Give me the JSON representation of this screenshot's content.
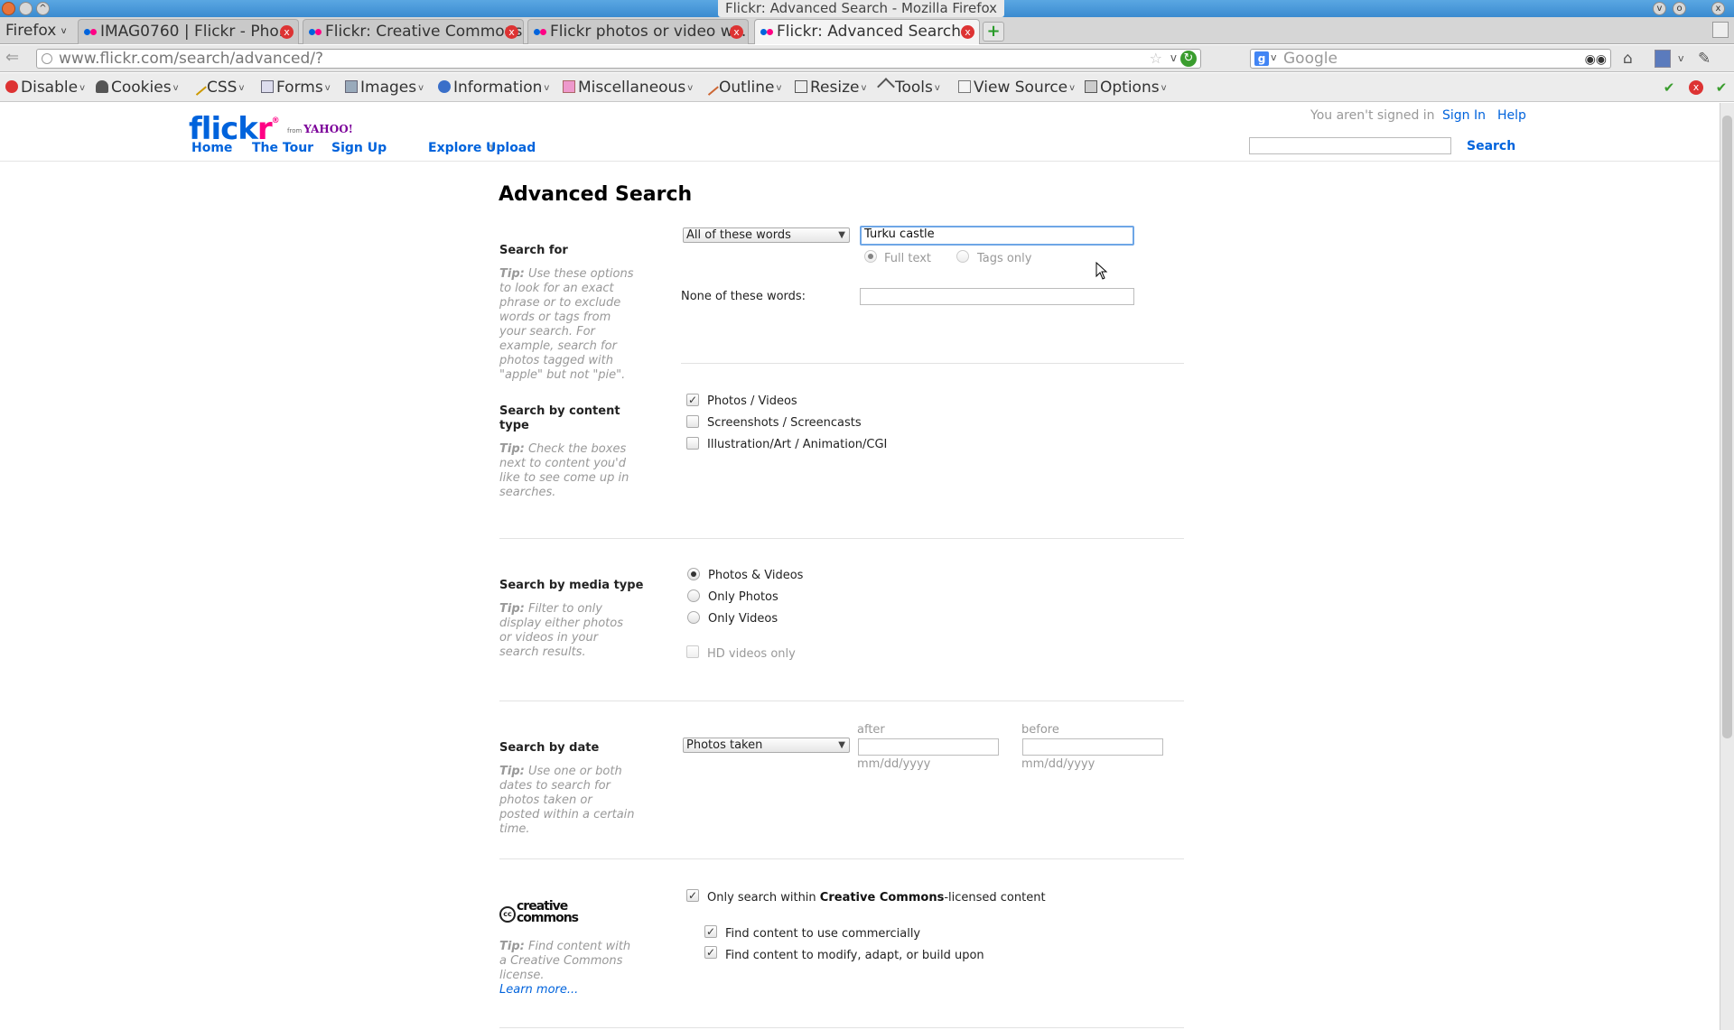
{
  "window": {
    "title": "Flickr: Advanced Search - Mozilla Firefox"
  },
  "browser": {
    "menu_label": "Firefox",
    "tabs": [
      {
        "label": "IMAG0760 | Flickr - Pho..."
      },
      {
        "label": "Flickr: Creative Commons"
      },
      {
        "label": "Flickr photos or video w..."
      },
      {
        "label": "Flickr: Advanced Search"
      }
    ],
    "url": "www.flickr.com/search/advanced/?",
    "search_placeholder": "Google"
  },
  "devtoolbar": {
    "items": [
      {
        "label": "Disable"
      },
      {
        "label": "Cookies"
      },
      {
        "label": "CSS"
      },
      {
        "label": "Forms"
      },
      {
        "label": "Images"
      },
      {
        "label": "Information"
      },
      {
        "label": "Miscellaneous"
      },
      {
        "label": "Outline"
      },
      {
        "label": "Resize"
      },
      {
        "label": "Tools"
      },
      {
        "label": "View Source"
      },
      {
        "label": "Options"
      }
    ]
  },
  "flickr": {
    "logo_blue": "flick",
    "logo_pink": "r",
    "logo_from": "from",
    "logo_yahoo": "YAHOO!",
    "nav": [
      "Home",
      "The Tour",
      "Sign Up",
      "Explore",
      "Upload"
    ],
    "signed_out": "You aren't signed in",
    "sign_in": "Sign In",
    "help": "Help",
    "search_button": "Search",
    "colors": {
      "blue": "#0063dc",
      "pink": "#ff0084"
    }
  },
  "page": {
    "title": "Advanced Search",
    "search_for": {
      "label": "Search for",
      "tip_bold": "Tip:",
      "tip": "Use these options to look for an exact phrase or to exclude words or tags from your search. For example, search for photos tagged with \"apple\" but not \"pie\".",
      "mode_select": "All of these words",
      "query": "Turku castle",
      "full_text": "Full text",
      "tags_only": "Tags only",
      "none_label": "None of these words:",
      "none_value": ""
    },
    "content_type": {
      "label": "Search by content type",
      "tip_bold": "Tip:",
      "tip": "Check the boxes next to content you'd like to see come up in searches.",
      "options": [
        {
          "label": "Photos / Videos",
          "checked": true
        },
        {
          "label": "Screenshots / Screencasts",
          "checked": false
        },
        {
          "label": "Illustration/Art / Animation/CGI",
          "checked": false
        }
      ]
    },
    "media_type": {
      "label": "Search by media type",
      "tip_bold": "Tip:",
      "tip": "Filter to only display either photos or videos in your search results.",
      "options": [
        {
          "label": "Photos & Videos",
          "selected": true
        },
        {
          "label": "Only Photos",
          "selected": false
        },
        {
          "label": "Only Videos",
          "selected": false
        }
      ],
      "hd_label": "HD videos only"
    },
    "date": {
      "label": "Search by date",
      "tip_bold": "Tip:",
      "tip": "Use one or both dates to search for photos taken or posted within a certain time.",
      "select": "Photos taken",
      "after": "after",
      "before": "before",
      "format": "mm/dd/yyyy"
    },
    "cc": {
      "logo_text": "creative commons",
      "logo_mark": "cc",
      "tip_bold": "Tip:",
      "tip": "Find content with a Creative Commons license.",
      "learn_more": "Learn more...",
      "only_prefix": "Only search within ",
      "only_bold": "Creative Commons",
      "only_suffix": "-licensed content",
      "commercial": "Find content to use commercially",
      "modify": "Find content to modify, adapt, or build upon"
    }
  }
}
